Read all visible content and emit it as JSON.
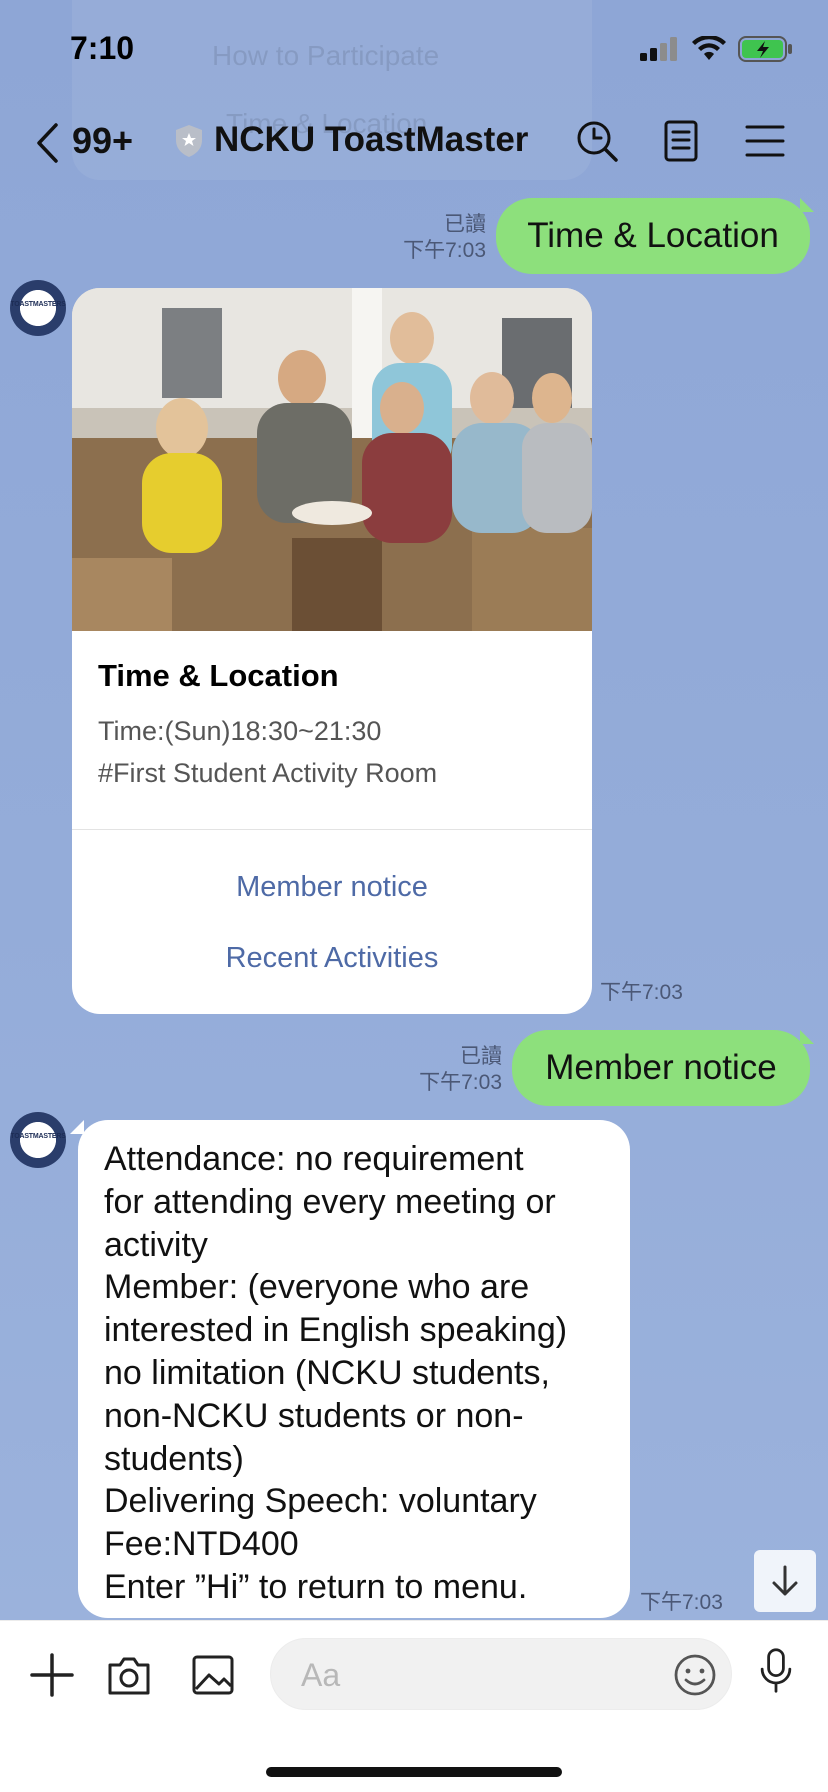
{
  "status_bar": {
    "time": "7:10",
    "icons": [
      "signal-icon",
      "wifi-icon",
      "battery-charging-icon"
    ]
  },
  "ghost_menu": [
    "How to Participate",
    "Time & Location"
  ],
  "header": {
    "unread_count": "99+",
    "chat_name": "NCKU ToastMaster",
    "icons": [
      "back-chevron-icon",
      "shield-badge-icon",
      "search-icon",
      "notes-icon",
      "menu-icon"
    ]
  },
  "messages": {
    "sent1": {
      "read_label": "已讀",
      "time": "下午7:03",
      "text": "Time & Location"
    },
    "card": {
      "avatar_text": "TOASTMASTERS",
      "title": "Time & Location",
      "line1": "Time:(Sun)18:30~21:30",
      "line2": "#First Student Activity Room",
      "link1": "Member notice",
      "link2": "Recent Activities",
      "time": "下午7:03"
    },
    "sent2": {
      "read_label": "已讀",
      "time": "下午7:03",
      "text": "Member notice"
    },
    "notice": {
      "avatar_text": "TOASTMASTERS",
      "lines": [
        "Attendance: no requirement",
        "for attending every meeting or",
        "activity",
        "Member: (everyone who are",
        "interested in English speaking)",
        "no limitation (NCKU students,",
        "non-NCKU students or non-",
        "students)",
        "Delivering Speech: voluntary",
        "Fee:NTD400",
        "Enter ”Hi” to return to menu."
      ],
      "time": "下午7:03"
    }
  },
  "input_bar": {
    "placeholder": "Aa",
    "icons": [
      "plus-icon",
      "camera-icon",
      "image-icon",
      "emoji-icon",
      "microphone-icon"
    ]
  },
  "colors": {
    "chat_background": "#92a9d6",
    "sent_bubble": "#8de07c",
    "link_text": "#4e6aa6"
  }
}
